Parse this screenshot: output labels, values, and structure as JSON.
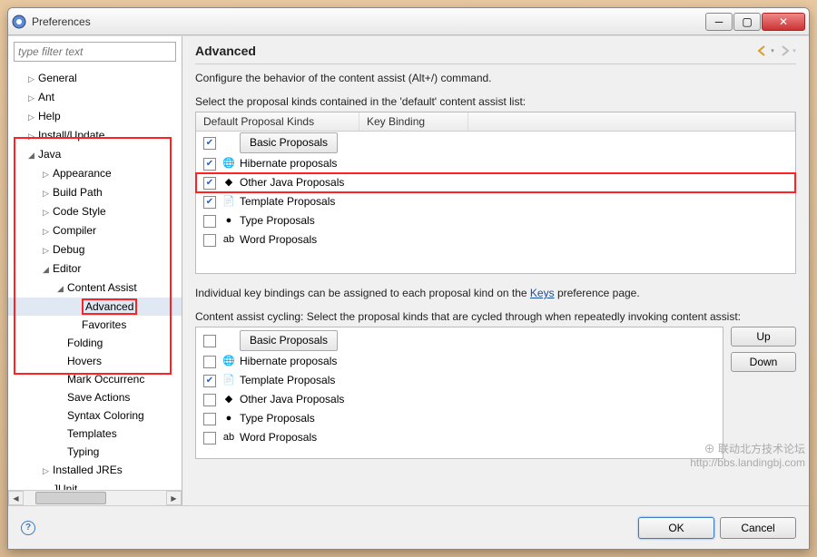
{
  "window": {
    "title": "Preferences"
  },
  "filter": {
    "placeholder": "type filter text"
  },
  "tree": [
    {
      "label": "General",
      "depth": 1,
      "exp": "▷"
    },
    {
      "label": "Ant",
      "depth": 1,
      "exp": "▷"
    },
    {
      "label": "Help",
      "depth": 1,
      "exp": "▷"
    },
    {
      "label": "Install/Update",
      "depth": 1,
      "exp": "▷"
    },
    {
      "label": "Java",
      "depth": 1,
      "exp": "◢"
    },
    {
      "label": "Appearance",
      "depth": 2,
      "exp": "▷"
    },
    {
      "label": "Build Path",
      "depth": 2,
      "exp": "▷"
    },
    {
      "label": "Code Style",
      "depth": 2,
      "exp": "▷"
    },
    {
      "label": "Compiler",
      "depth": 2,
      "exp": "▷"
    },
    {
      "label": "Debug",
      "depth": 2,
      "exp": "▷"
    },
    {
      "label": "Editor",
      "depth": 2,
      "exp": "◢"
    },
    {
      "label": "Content Assist",
      "depth": 3,
      "exp": "◢"
    },
    {
      "label": "Advanced",
      "depth": 4,
      "exp": "",
      "sel": true,
      "hl": true
    },
    {
      "label": "Favorites",
      "depth": 4,
      "exp": ""
    },
    {
      "label": "Folding",
      "depth": 3,
      "exp": ""
    },
    {
      "label": "Hovers",
      "depth": 3,
      "exp": ""
    },
    {
      "label": "Mark Occurrenc",
      "depth": 3,
      "exp": ""
    },
    {
      "label": "Save Actions",
      "depth": 3,
      "exp": ""
    },
    {
      "label": "Syntax Coloring",
      "depth": 3,
      "exp": ""
    },
    {
      "label": "Templates",
      "depth": 3,
      "exp": ""
    },
    {
      "label": "Typing",
      "depth": 3,
      "exp": ""
    },
    {
      "label": "Installed JREs",
      "depth": 2,
      "exp": "▷"
    },
    {
      "label": "JUnit",
      "depth": 2,
      "exp": ""
    }
  ],
  "main": {
    "heading": "Advanced",
    "desc": "Configure the behavior of the content assist (Alt+/) command.",
    "sel_label": "Select the proposal kinds contained in the 'default' content assist list:",
    "col1": "Default Proposal Kinds",
    "col2": "Key Binding",
    "rows1": [
      {
        "checked": true,
        "icon": "",
        "label": "Basic Proposals",
        "btn": true
      },
      {
        "checked": true,
        "icon": "🌐",
        "label": "Hibernate proposals"
      },
      {
        "checked": true,
        "icon": "◆",
        "label": "Other Java Proposals",
        "hl": true
      },
      {
        "checked": true,
        "icon": "📄",
        "label": "Template Proposals"
      },
      {
        "checked": false,
        "icon": "●",
        "label": "Type Proposals"
      },
      {
        "checked": false,
        "icon": "ab",
        "label": "Word Proposals"
      }
    ],
    "bindings_text_pre": "Individual key bindings can be assigned to each proposal kind on the ",
    "bindings_link": "Keys",
    "bindings_text_post": " preference page.",
    "cycle_label": "Content assist cycling: Select the proposal kinds that are cycled through when repeatedly invoking content assist:",
    "rows2": [
      {
        "checked": false,
        "icon": "",
        "label": "Basic Proposals",
        "btn": true
      },
      {
        "checked": false,
        "icon": "🌐",
        "label": "Hibernate proposals"
      },
      {
        "checked": true,
        "icon": "📄",
        "label": "Template Proposals"
      },
      {
        "checked": false,
        "icon": "◆",
        "label": "Other Java Proposals"
      },
      {
        "checked": false,
        "icon": "●",
        "label": "Type Proposals"
      },
      {
        "checked": false,
        "icon": "ab",
        "label": "Word Proposals"
      }
    ],
    "up": "Up",
    "down": "Down"
  },
  "footer": {
    "ok": "OK",
    "cancel": "Cancel"
  },
  "watermark": {
    "l1": "联动北方技术论坛",
    "l2": "http://bbs.landingbj.com"
  }
}
